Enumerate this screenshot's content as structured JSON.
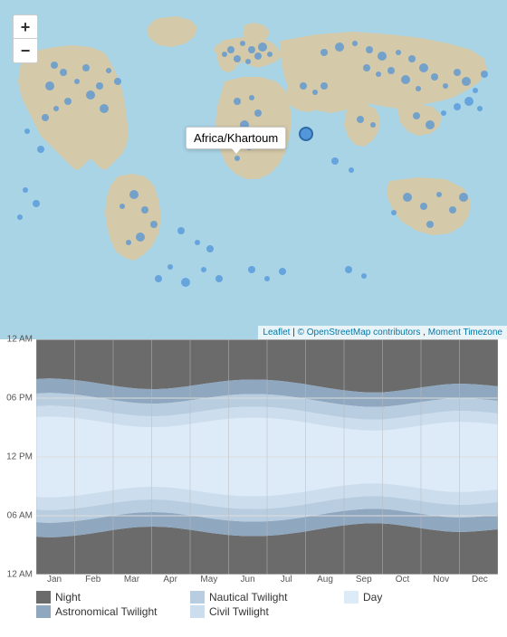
{
  "map": {
    "tooltip": "Africa/Khartoum",
    "zoom_in": "+",
    "zoom_out": "−",
    "attribution_leaflet": "Leaflet",
    "attribution_osm": "© OpenStreetMap contributors",
    "attribution_moment": "Moment Timezone"
  },
  "chart": {
    "y_labels": [
      "12 AM",
      "06 PM",
      "12 PM",
      "06 AM",
      "12 AM"
    ],
    "x_labels": [
      "Jan",
      "Feb",
      "Mar",
      "Apr",
      "May",
      "Jun",
      "Jul",
      "Aug",
      "Sep",
      "Oct",
      "Nov",
      "Dec"
    ],
    "colors": {
      "night": "#666",
      "astronomical": "#999",
      "nautical": "#c5d4e8",
      "civil": "#dce8f5",
      "day": "#eef4fb"
    }
  },
  "legend": {
    "items": [
      {
        "label": "Night",
        "color": "#6b6b6b"
      },
      {
        "label": "Nautical Twilight",
        "color": "#b8cde0"
      },
      {
        "label": "Day",
        "color": "#ddeaf7"
      },
      {
        "label": "Astronomical Twilight",
        "color": "#8fa8c0"
      },
      {
        "label": "Civil Twilight",
        "color": "#ccdded"
      }
    ]
  }
}
